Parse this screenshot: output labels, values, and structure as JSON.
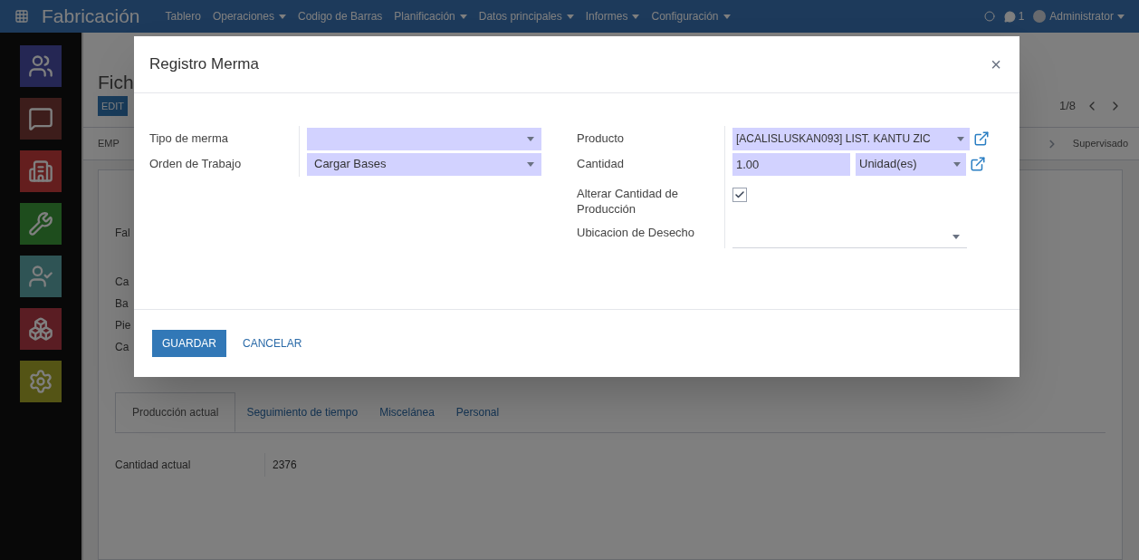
{
  "navbar": {
    "app_title": "Fabricación",
    "menu": [
      {
        "label": "Tablero",
        "dropdown": false
      },
      {
        "label": "Operaciones",
        "dropdown": true
      },
      {
        "label": "Codigo de Barras",
        "dropdown": false
      },
      {
        "label": "Planificación",
        "dropdown": true
      },
      {
        "label": "Datos principales",
        "dropdown": true
      },
      {
        "label": "Informes",
        "dropdown": true
      },
      {
        "label": "Configuración",
        "dropdown": true
      }
    ],
    "chat_count": "1",
    "user": "Administrator"
  },
  "sidebar": {
    "apps": [
      {
        "kind": "people"
      },
      {
        "kind": "chat"
      },
      {
        "kind": "building"
      },
      {
        "kind": "wrench"
      },
      {
        "kind": "user-check"
      },
      {
        "kind": "cubes"
      },
      {
        "kind": "gear"
      }
    ]
  },
  "record": {
    "title": "Fich",
    "edit_button": "EDIT",
    "status_left": "EMP",
    "pager": "1/8",
    "stage": "Supervisado",
    "field_labels": [
      "Fal",
      "Ca",
      "Ba",
      "Pie",
      "Ca"
    ],
    "tabs": [
      {
        "label": "Producción actual",
        "selected": true
      },
      {
        "label": "Seguimiento de tiempo",
        "selected": false
      },
      {
        "label": "Miscelánea",
        "selected": false
      },
      {
        "label": "Personal",
        "selected": false
      }
    ],
    "tab_field": {
      "label": "Cantidad actual",
      "value": "2376"
    }
  },
  "dialog": {
    "title": "Registro Merma",
    "close": "×",
    "left_fields": [
      {
        "label": "Tipo de merma",
        "kind": "select"
      },
      {
        "label": "Orden de Trabajo",
        "kind": "select",
        "value": "Cargar Bases"
      }
    ],
    "right_fields": [
      {
        "label": "Producto",
        "kind": "select-link",
        "value": "[ACALISLUSKAN093] LIST. KANTU ZIC"
      },
      {
        "label": "Cantidad",
        "kind": "quantity",
        "value": "1.00",
        "unit": "Unidad(es)"
      },
      {
        "label": "Alterar Cantidad de Producción",
        "kind": "checkbox",
        "checked": true
      },
      {
        "label": "Ubicacion de Desecho",
        "kind": "select-plain"
      }
    ],
    "buttons": [
      {
        "label": "GUARDAR",
        "kind": "primary"
      },
      {
        "label": "CANCELAR",
        "kind": "link"
      }
    ]
  }
}
